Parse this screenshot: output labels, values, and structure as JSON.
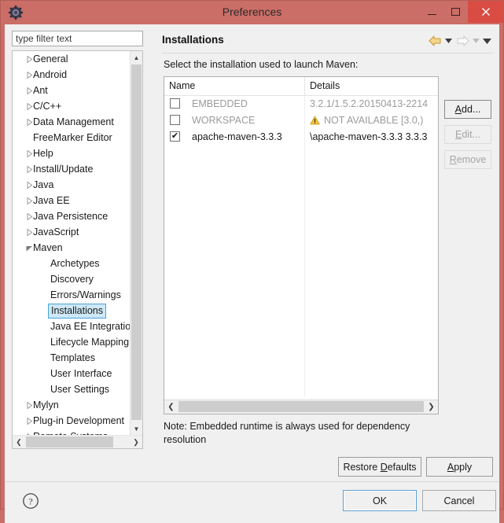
{
  "window": {
    "title": "Preferences",
    "app_icon": "gear-icon",
    "titlebar_color": "#cb6e67",
    "close_button_color": "#d94c43",
    "controls": {
      "minimize": "–",
      "maximize": "☐",
      "close": "✕"
    }
  },
  "filter": {
    "value": "",
    "placeholder": "type filter text"
  },
  "tree": {
    "items": [
      {
        "label": "General",
        "depth": 0,
        "expandable": true,
        "expanded": false,
        "selected": false
      },
      {
        "label": "Android",
        "depth": 0,
        "expandable": true,
        "expanded": false,
        "selected": false
      },
      {
        "label": "Ant",
        "depth": 0,
        "expandable": true,
        "expanded": false,
        "selected": false
      },
      {
        "label": "C/C++",
        "depth": 0,
        "expandable": true,
        "expanded": false,
        "selected": false
      },
      {
        "label": "Data Management",
        "depth": 0,
        "expandable": true,
        "expanded": false,
        "selected": false
      },
      {
        "label": "FreeMarker Editor",
        "depth": 0,
        "expandable": false,
        "expanded": false,
        "selected": false
      },
      {
        "label": "Help",
        "depth": 0,
        "expandable": true,
        "expanded": false,
        "selected": false
      },
      {
        "label": "Install/Update",
        "depth": 0,
        "expandable": true,
        "expanded": false,
        "selected": false
      },
      {
        "label": "Java",
        "depth": 0,
        "expandable": true,
        "expanded": false,
        "selected": false
      },
      {
        "label": "Java EE",
        "depth": 0,
        "expandable": true,
        "expanded": false,
        "selected": false
      },
      {
        "label": "Java Persistence",
        "depth": 0,
        "expandable": true,
        "expanded": false,
        "selected": false
      },
      {
        "label": "JavaScript",
        "depth": 0,
        "expandable": true,
        "expanded": false,
        "selected": false
      },
      {
        "label": "Maven",
        "depth": 0,
        "expandable": true,
        "expanded": true,
        "selected": false
      },
      {
        "label": "Archetypes",
        "depth": 1,
        "expandable": false,
        "expanded": false,
        "selected": false
      },
      {
        "label": "Discovery",
        "depth": 1,
        "expandable": false,
        "expanded": false,
        "selected": false
      },
      {
        "label": "Errors/Warnings",
        "depth": 1,
        "expandable": false,
        "expanded": false,
        "selected": false
      },
      {
        "label": "Installations",
        "depth": 1,
        "expandable": false,
        "expanded": false,
        "selected": true
      },
      {
        "label": "Java EE Integration",
        "depth": 1,
        "expandable": false,
        "expanded": false,
        "selected": false
      },
      {
        "label": "Lifecycle Mapping",
        "depth": 1,
        "expandable": false,
        "expanded": false,
        "selected": false
      },
      {
        "label": "Templates",
        "depth": 1,
        "expandable": false,
        "expanded": false,
        "selected": false
      },
      {
        "label": "User Interface",
        "depth": 1,
        "expandable": false,
        "expanded": false,
        "selected": false
      },
      {
        "label": "User Settings",
        "depth": 1,
        "expandable": false,
        "expanded": false,
        "selected": false
      },
      {
        "label": "Mylyn",
        "depth": 0,
        "expandable": true,
        "expanded": false,
        "selected": false
      },
      {
        "label": "Plug-in Development",
        "depth": 0,
        "expandable": true,
        "expanded": false,
        "selected": false
      },
      {
        "label": "Remote Systems",
        "depth": 0,
        "expandable": true,
        "expanded": false,
        "selected": false
      }
    ],
    "selection_highlight_color": "#cde8f6",
    "selection_border_color": "#4aa3d8",
    "scroll_up_glyph": "▲",
    "scroll_down_glyph": "▼",
    "scroll_left_glyph": "❮",
    "scroll_right_glyph": "❯"
  },
  "panel": {
    "title": "Installations",
    "instruction": "Select the installation used to launch Maven:",
    "nav": {
      "back_icon": "back-arrow-icon",
      "back_dropdown_icon": "chevron-down-icon",
      "forward_icon": "forward-arrow-icon",
      "forward_dropdown_icon": "chevron-down-icon",
      "menu_icon": "chevron-down-icon"
    }
  },
  "table": {
    "columns": [
      "Name",
      "Details"
    ],
    "rows": [
      {
        "checked": false,
        "enabled": false,
        "name": "EMBEDDED",
        "details": "3.2.1/1.5.2.20150413-2214",
        "warning": false
      },
      {
        "checked": false,
        "enabled": false,
        "name": "WORKSPACE",
        "details": "NOT AVAILABLE [3.0,)",
        "warning": true,
        "warning_icon": "warning-triangle-icon"
      },
      {
        "checked": true,
        "enabled": true,
        "name": "apache-maven-3.3.3",
        "details": "\\apache-maven-3.3.3 3.3.3",
        "warning": false
      }
    ],
    "checkmark_glyph": "✔",
    "scroll_left_glyph": "❮",
    "scroll_right_glyph": "❯"
  },
  "side_buttons": [
    {
      "label": "Add...",
      "mnemonic": "A",
      "enabled": true
    },
    {
      "label": "Edit...",
      "mnemonic": "E",
      "enabled": false
    },
    {
      "label": "Remove",
      "mnemonic": "R",
      "enabled": false
    }
  ],
  "note": "Note: Embedded runtime is always used for dependency resolution",
  "action_buttons": {
    "restore_defaults": "Restore Defaults",
    "apply": "Apply"
  },
  "footer": {
    "help_icon": "question-mark-icon",
    "ok": "OK",
    "cancel": "Cancel",
    "default_button_border_color": "#5c9fd4"
  }
}
